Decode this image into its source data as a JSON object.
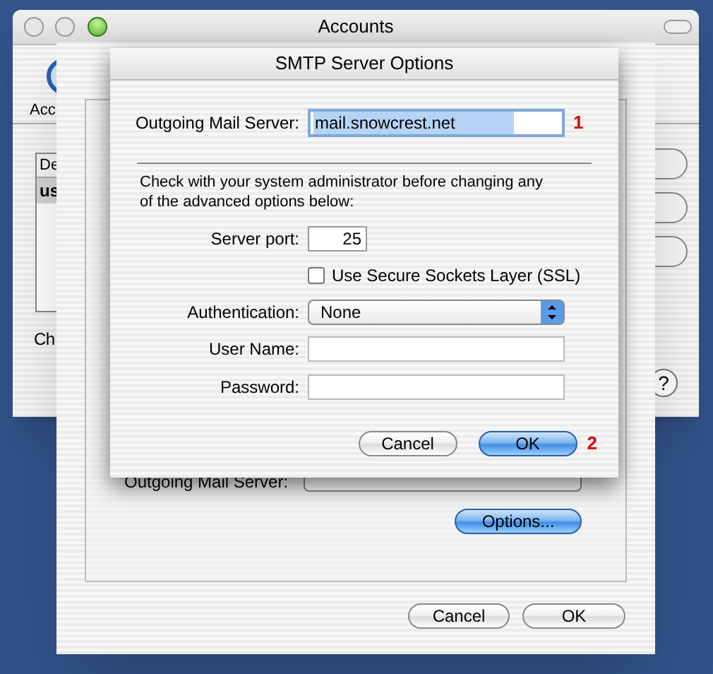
{
  "accounts_window": {
    "title": "Accounts",
    "toolbar_label": "Acc",
    "list": {
      "column_1": "De",
      "rows": [
        {
          "text": "us",
          "selected": true
        }
      ]
    },
    "text_1": "Ch",
    "help_button": "?"
  },
  "account_dialog": {
    "server_label": "Outgoing Mail Server:",
    "options_button": "Options...",
    "buttons": [
      {
        "label": "Cancel",
        "default": false
      },
      {
        "label": "OK",
        "default": false
      }
    ]
  },
  "smtp_sheet": {
    "title": "SMTP Server Options",
    "server": {
      "label": "Outgoing Mail Server:",
      "value": "mail.snowcrest.net",
      "selected": true
    },
    "marker_1": "1",
    "note": "Check with your system administrator before changing any of the advanced options below:",
    "port": {
      "label": "Server port:",
      "value": "25"
    },
    "ssl": {
      "label": "Use Secure Sockets Layer (SSL)",
      "checked": false
    },
    "authentication": {
      "label": "Authentication:",
      "value": "None"
    },
    "user_name": {
      "label": "User Name:"
    },
    "password": {
      "label": "Password:"
    },
    "buttons": [
      {
        "label": "Cancel",
        "default": false
      },
      {
        "label": "OK",
        "default": true
      }
    ],
    "marker_2": "2"
  }
}
